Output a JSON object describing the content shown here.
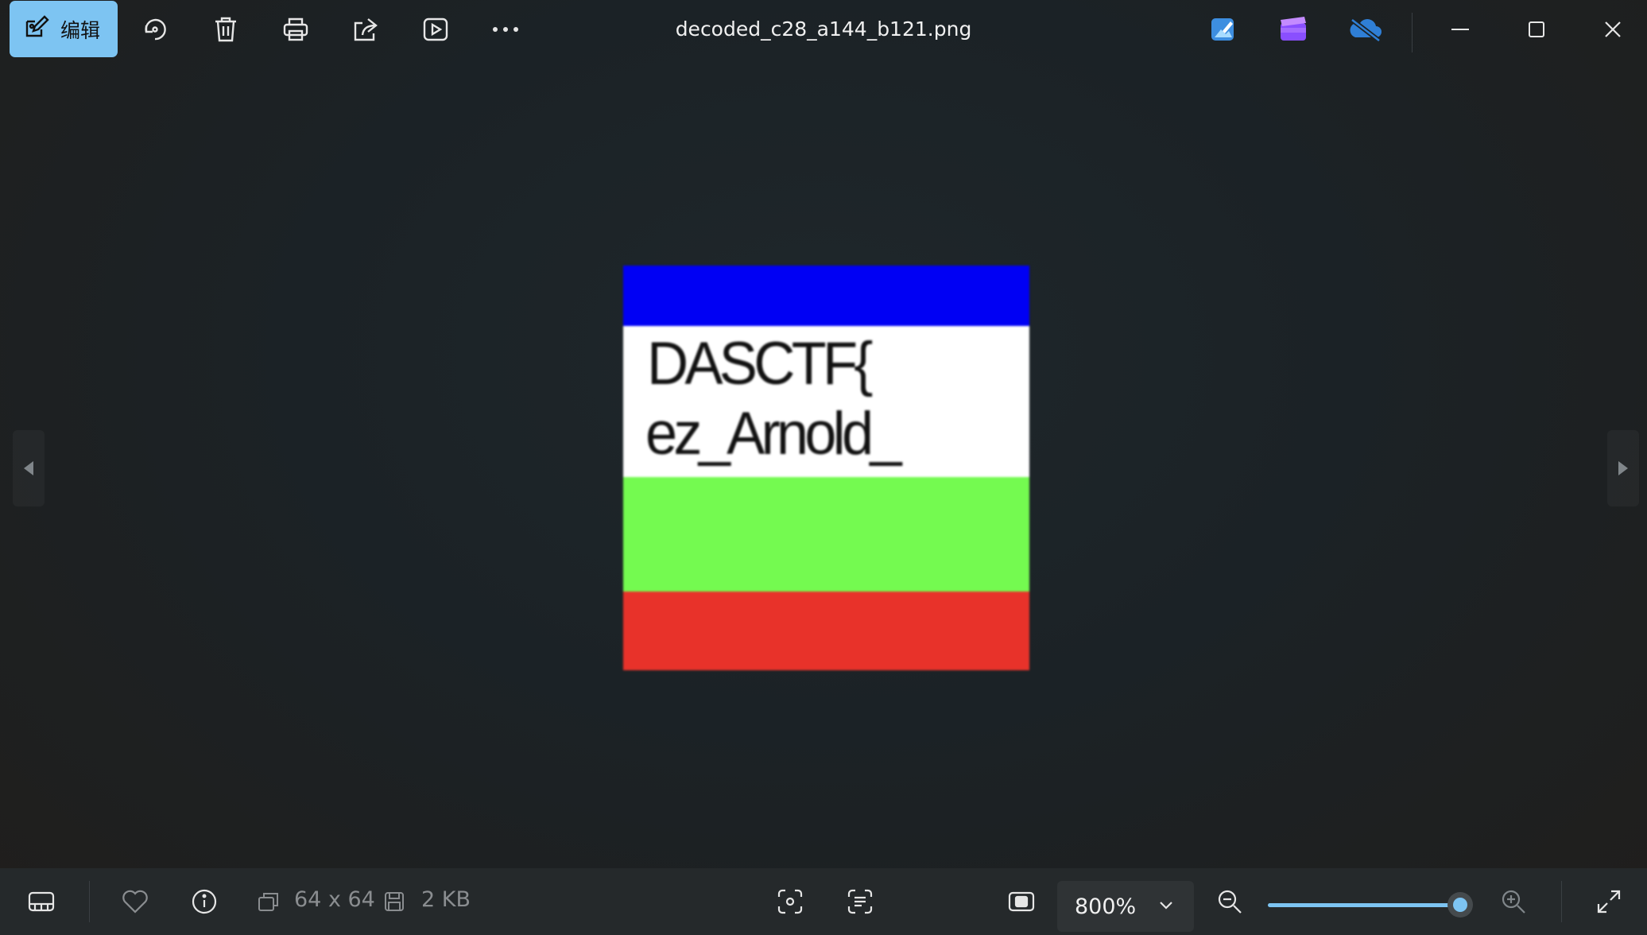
{
  "toolbar": {
    "edit_label": "编辑",
    "icons": [
      "edit-icon",
      "rotate-icon",
      "delete-icon",
      "print-icon",
      "share-icon",
      "slideshow-icon",
      "more-icon"
    ]
  },
  "window": {
    "title": "decoded_c28_a144_b121.png",
    "app_icons": [
      "photos-editor-icon",
      "clipchamp-icon",
      "onedrive-off-icon"
    ],
    "controls": [
      "minimize-icon",
      "maximize-icon",
      "close-icon"
    ]
  },
  "image": {
    "line1": "DASCTF{",
    "line2": "ez_Arnold_",
    "colors": {
      "top": "#0000f4",
      "middle": "#ffffff",
      "lower": "#74fa50",
      "bottom": "#e8322a"
    }
  },
  "footer": {
    "dimensions": "64 x 64",
    "file_size": "2 KB",
    "zoom_value": "800%",
    "zoom_level": 1.0,
    "icons": [
      "filmstrip-icon",
      "favorite-icon",
      "info-icon",
      "dimensions-icon",
      "save-icon",
      "visual-search-icon",
      "text-extract-icon",
      "fit-screen-icon",
      "zoom-out-icon",
      "zoom-in-icon",
      "fullscreen-icon"
    ]
  },
  "accent": "#7dc4f2"
}
